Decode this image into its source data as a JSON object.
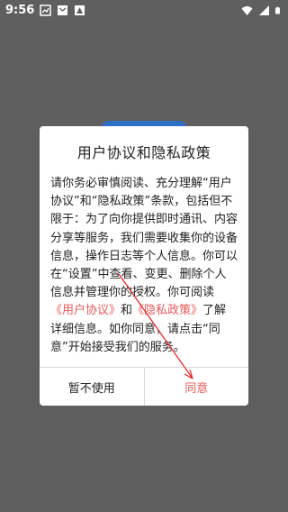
{
  "status_bar": {
    "time": "9:56",
    "left_icons": [
      "notification-icon",
      "mail-icon",
      "image-icon"
    ],
    "right_icons": [
      "wifi-icon",
      "signal-icon",
      "battery-icon"
    ]
  },
  "dialog": {
    "title": "用户协议和隐私政策",
    "body_p1": "请你务必审慎阅读、充分理解“用户协议”和“隐私政策”条款，包括但不限于：为了向你提供即时通讯、内容分享等服务，我们需要收集你的设备信息，操作日志等个人信息。你可以在“设置”中查看、变更、删除个人信息并管理你的授权。你可阅读",
    "link_user_agreement": "《用户协议》",
    "and": "和",
    "link_privacy_policy": "《隐私政策》",
    "body_p2": "了解详细信息。如你同意，请点击“同意”开始接受我们的服务。",
    "reject_label": "暂不使用",
    "agree_label": "同意"
  },
  "colors": {
    "link": "#e85a5a",
    "overlay": "#5f5f5f"
  }
}
